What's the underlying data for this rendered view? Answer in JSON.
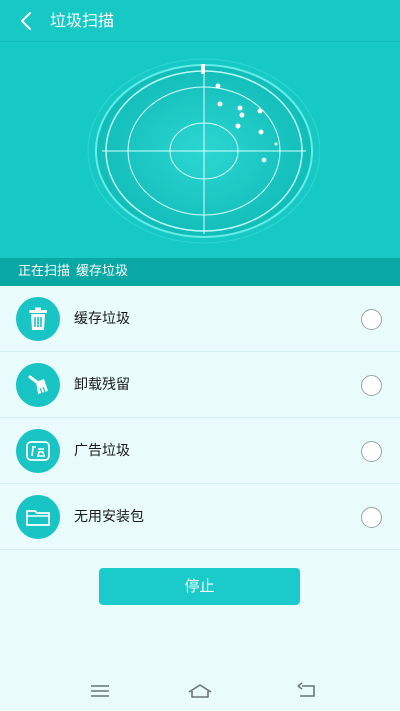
{
  "header": {
    "title": "垃圾扫描",
    "back_icon": "chevron-left-icon"
  },
  "colors": {
    "primary": "#17c9c4",
    "status_bar": "#0aa8a5",
    "background": "#e9fcfb",
    "button": "#1bcbcb"
  },
  "scan_status": {
    "prefix": "正在扫描",
    "current_item": "缓存垃圾"
  },
  "items": [
    {
      "label": "缓存垃圾",
      "icon": "trash-can-icon"
    },
    {
      "label": "卸载残留",
      "icon": "broom-icon"
    },
    {
      "label": "广告垃圾",
      "icon": "ad-icon"
    },
    {
      "label": "无用安装包",
      "icon": "folder-icon"
    }
  ],
  "stop_button": {
    "label": "停止"
  },
  "navbar": {
    "menu_icon": "menu-icon",
    "home_icon": "home-icon",
    "back_icon": "back-arrow-icon"
  }
}
